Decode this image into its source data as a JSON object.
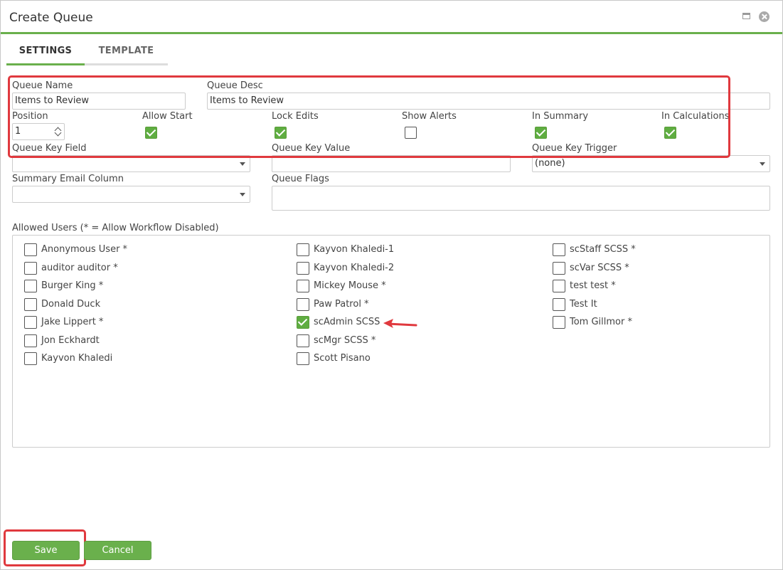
{
  "window": {
    "title": "Create Queue"
  },
  "tabs": [
    {
      "label": "SETTINGS"
    },
    {
      "label": "TEMPLATE"
    }
  ],
  "form": {
    "queue_name": {
      "label": "Queue Name",
      "value": "Items to Review"
    },
    "queue_desc": {
      "label": "Queue Desc",
      "value": "Items to Review"
    },
    "position": {
      "label": "Position",
      "value": "1"
    },
    "allow_start": {
      "label": "Allow Start",
      "checked": true
    },
    "lock_edits": {
      "label": "Lock Edits",
      "checked": true
    },
    "show_alerts": {
      "label": "Show Alerts",
      "checked": false
    },
    "in_summary": {
      "label": "In Summary",
      "checked": true
    },
    "in_calculations": {
      "label": "In Calculations",
      "checked": true
    },
    "queue_key_field": {
      "label": "Queue Key Field",
      "value": ""
    },
    "queue_key_value": {
      "label": "Queue Key Value",
      "value": ""
    },
    "queue_key_trigger": {
      "label": "Queue Key Trigger",
      "value": "(none)"
    },
    "summary_email_column": {
      "label": "Summary Email Column",
      "value": ""
    },
    "queue_flags": {
      "label": "Queue Flags",
      "value": ""
    }
  },
  "allowed_users": {
    "label": "Allowed Users (* = Allow Workflow Disabled)",
    "columns": [
      [
        {
          "name": "Anonymous User *",
          "checked": false
        },
        {
          "name": "auditor auditor *",
          "checked": false
        },
        {
          "name": "Burger King *",
          "checked": false
        },
        {
          "name": "Donald Duck",
          "checked": false
        },
        {
          "name": "Jake Lippert *",
          "checked": false
        },
        {
          "name": "Jon Eckhardt",
          "checked": false
        },
        {
          "name": "Kayvon Khaledi",
          "checked": false
        }
      ],
      [
        {
          "name": "Kayvon Khaledi-1",
          "checked": false
        },
        {
          "name": "Kayvon Khaledi-2",
          "checked": false
        },
        {
          "name": "Mickey Mouse *",
          "checked": false
        },
        {
          "name": "Paw Patrol *",
          "checked": false
        },
        {
          "name": "scAdmin SCSS",
          "checked": true
        },
        {
          "name": "scMgr SCSS *",
          "checked": false
        },
        {
          "name": "Scott Pisano",
          "checked": false
        }
      ],
      [
        {
          "name": "scStaff SCSS *",
          "checked": false
        },
        {
          "name": "scVar SCSS *",
          "checked": false
        },
        {
          "name": "test test *",
          "checked": false
        },
        {
          "name": "Test It",
          "checked": false
        },
        {
          "name": "Tom Gillmor *",
          "checked": false
        }
      ]
    ]
  },
  "buttons": {
    "save": "Save",
    "cancel": "Cancel"
  },
  "colors": {
    "accent": "#6ab04c",
    "highlight": "#e0393e"
  }
}
